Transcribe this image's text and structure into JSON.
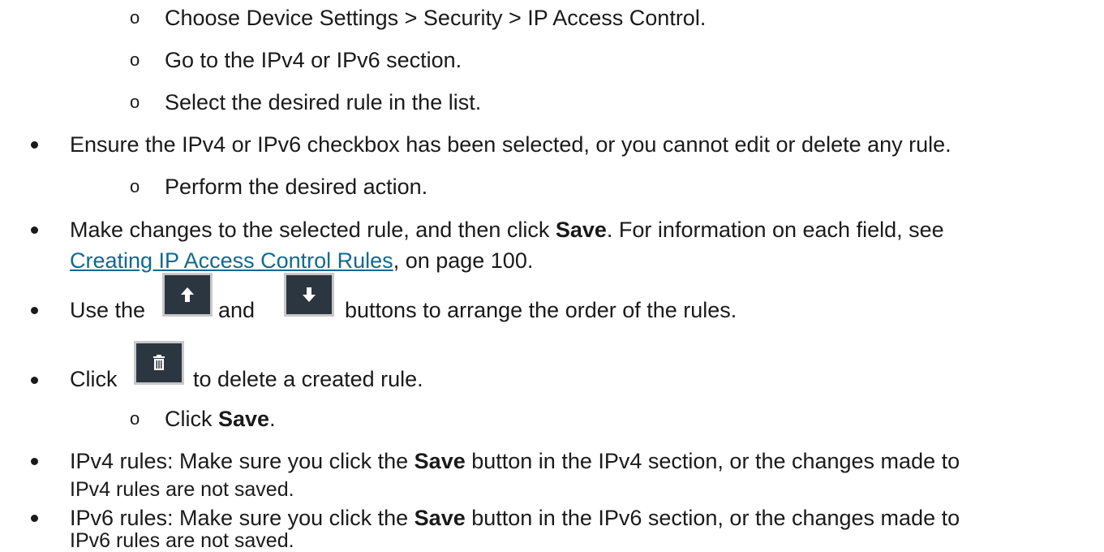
{
  "glyphs": {
    "sub_bullet": "o"
  },
  "items": {
    "sub1": "Choose Device Settings > Security > IP Access Control.",
    "sub2": "Go to the IPv4 or IPv6 section.",
    "sub3": "Select the desired rule in the list.",
    "b1": "Ensure the IPv4 or IPv6 checkbox has been selected, or you cannot edit or delete any rule.",
    "sub4": "Perform the desired action.",
    "b2_pre": "Make changes to the selected rule, and then click ",
    "b2_bold": "Save",
    "b2_post": ". For information on each field, see",
    "b2_link": "Creating IP Access Control Rules",
    "b2_tail": ", on page 100.",
    "b3_pre": "Use the",
    "b3_mid": "and",
    "b3_post": "buttons to arrange the order of the rules.",
    "b4_pre": "Click",
    "b4_post": "to delete a created rule.",
    "sub5_pre": "Click ",
    "sub5_bold": "Save",
    "sub5_post": ".",
    "b5_pre": "IPv4 rules: Make sure you click the ",
    "b5_bold": "Save",
    "b5_post": " button in the IPv4 section, or the changes made to",
    "b5_line2": "IPv4 rules are not saved.",
    "b6_pre": "IPv6 rules: Make sure you click the ",
    "b6_bold": "Save",
    "b6_post": " button in the IPv6 section, or the changes made to",
    "b6_line2": "IPv6 rules are not saved."
  },
  "icons": {
    "up": "arrow-up-icon",
    "down": "arrow-down-icon",
    "delete": "trash-icon"
  },
  "colors": {
    "text": "#1a1a1a",
    "link": "#0f6a8f",
    "icon_bg": "#2c3640"
  }
}
